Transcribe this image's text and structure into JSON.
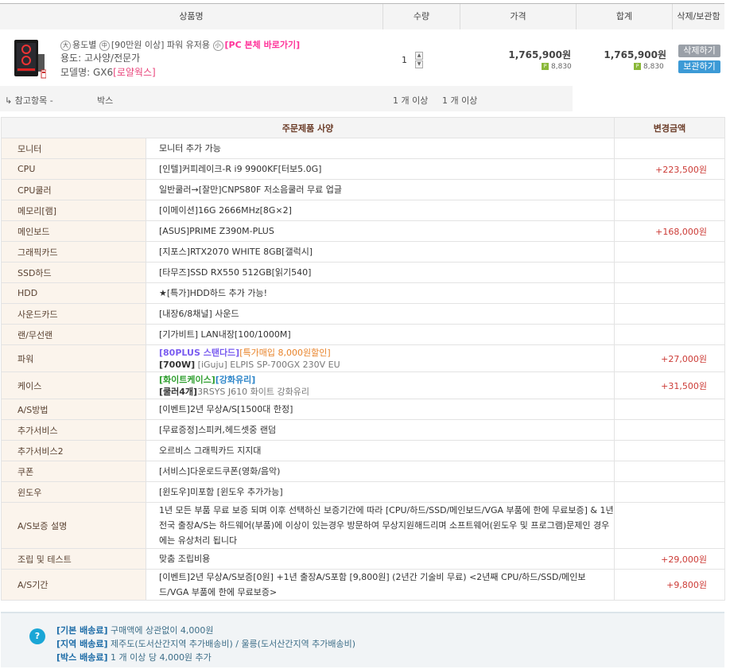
{
  "header": {
    "col_product": "상품명",
    "col_qty": "수량",
    "col_price": "가격",
    "col_total": "합계",
    "col_actions": "삭제/보관함"
  },
  "product": {
    "tag1": "大",
    "category": "용도별",
    "tag2": "中",
    "subcategory": "[90만원 이상] 파워 유저용",
    "tag3": "小",
    "link": "[PC 본체 바로가기]",
    "usage": "용도: 고사양/전문가",
    "model_prefix": "모델명: GX6",
    "model_suffix": "[로얄웍스]",
    "quantity": "1",
    "price": "1,765,900원",
    "price_points": "8,830",
    "total": "1,765,900원",
    "total_points": "8,830",
    "delete_label": "삭제하기",
    "save_label": "보관하기",
    "colors": {
      "delete_btn": "#9aa0a8",
      "save_btn": "#3c9ad6",
      "link": "#ff3399"
    }
  },
  "reference": {
    "label": "↳ 참고항목 -",
    "item": "박스",
    "qty1": "1 개 이상",
    "qty2": "1 개 이상"
  },
  "spec": {
    "header_spec": "주문제품 사양",
    "header_amount": "변경금액",
    "rows": [
      {
        "label": "모니터",
        "value": "모니터 추가 가능",
        "amount": ""
      },
      {
        "label": "CPU",
        "value": "[인텔]커피레이크-R i9 9900KF[터보5.0G]",
        "amount": "+223,500원"
      },
      {
        "label": "CPU쿨러",
        "value": "일반쿨러→[잘만]CNPS80F 저소음쿨러 무료 업글",
        "amount": ""
      },
      {
        "label": "메모리[램]",
        "value": "[이메이션]16G 2666MHz[8G×2]",
        "amount": ""
      },
      {
        "label": "메인보드",
        "value": "[ASUS]PRIME Z390M-PLUS",
        "amount": "+168,000원"
      },
      {
        "label": "그래픽카드",
        "value": "[지포스]RTX2070 WHITE 8GB[갤럭시]",
        "amount": ""
      },
      {
        "label": "SSD하드",
        "value": "[타무즈]SSD RX550 512GB[읽기540]",
        "amount": ""
      },
      {
        "label": "HDD",
        "value": "★[특가]HDD하드 추가 가능!",
        "amount": ""
      },
      {
        "label": "사운드카드",
        "value": "[내장6/8채널] 사운드",
        "amount": ""
      },
      {
        "label": "랜/무선랜",
        "value": "[기가비트] LAN내장[100/1000M]",
        "amount": ""
      },
      {
        "label": "파워",
        "value_a": "[80PLUS 스탠다드]",
        "value_b": "[특가매입 8,000원할인]",
        "value_c": "[700W]",
        "value_d": " [iGuju] ELPIS SP-700GX 230V EU",
        "amount": "+27,000원"
      },
      {
        "label": "케이스",
        "value_a": "[화이트케이스]",
        "value_b": "[강화유리]",
        "value_c": "[쿨러4개]",
        "value_d": "3RSYS J610 화이트 강화유리",
        "amount": "+31,500원"
      },
      {
        "label": "A/S방법",
        "value": "[이벤트]2년 무상A/S[1500대 한정]",
        "amount": ""
      },
      {
        "label": "추가서비스",
        "value": "[무료증정]스피커,헤드셋중 랜덤",
        "amount": ""
      },
      {
        "label": "추가서비스2",
        "value": "오르비스 그래픽카드 지지대",
        "amount": ""
      },
      {
        "label": "쿠폰",
        "value": "[서비스]다운로드쿠폰(영화/음악)",
        "amount": ""
      },
      {
        "label": "윈도우",
        "value": "[윈도우]미포함 [윈도우 추가가능]",
        "amount": ""
      },
      {
        "label": "A/S보증 설명",
        "value": "1년 모든 부품 무료 보증 되며 이후 선택하신 보증기간에 따라 [CPU/하드/SSD/메인보드/VGA 부품에 한에 무료보증] & 1년 전국 출장A/S는 하드웨어(부품)에 이상이 있는경우 방문하여 무상지원해드리며 소프트웨어(윈도우 및 프로그램)문제인 경우에는 유상처리 됩니다",
        "amount": ""
      },
      {
        "label": "조립 및 테스트",
        "value": "맞춤 조립비용",
        "amount": "+29,000원"
      },
      {
        "label": "A/S기간",
        "value": "[이벤트]2년 무상A/S보증[0원] +1년 출장A/S포함 [9,800원] (2년간 기술비 무료) <2년째 CPU/하드/SSD/메인보드/VGA 부품에 한에 무료보증>",
        "amount": "+9,800원"
      }
    ]
  },
  "shipping": {
    "icon": "?",
    "basic_label": "[기본 배송료]",
    "basic_text": " 구매액에 상관없이 4,000원",
    "region_label": "[지역 배송료]",
    "region_text": " 제주도(도서산간지역 추가배송비) / 울릉(도서산간지역 추가배송비)",
    "box_label": "[박스 배송료]",
    "box_text": " 1 개 이상 당 4,000원 추가"
  }
}
